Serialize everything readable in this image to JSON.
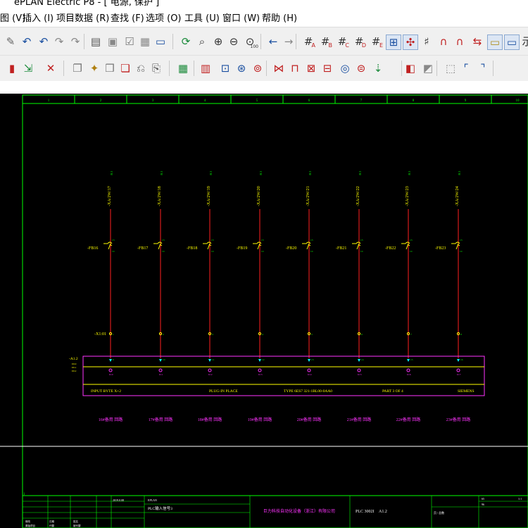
{
  "window": {
    "title_fragment": "ePLAN Electric P8 - [ 电源, 保护 ]"
  },
  "menu": {
    "items": [
      "图 (V)",
      "插入 (I)",
      "项目数据 (R)",
      "查找 (F)",
      "选项 (O)",
      "工具 (U)",
      "窗口 (W)",
      "帮助 (H)"
    ]
  },
  "toolbar1": {
    "icons": [
      "brush-icon",
      "undo-icon",
      "undo-alt-icon",
      "redo-icon",
      "redo-alt-icon",
      "page-layout-icon",
      "page-image-icon",
      "page-check-icon",
      "grid-table-icon",
      "window-icon",
      "refresh-icon",
      "zoom-window-icon",
      "zoom-in-icon",
      "zoom-out-icon",
      "zoom-100-icon",
      "back-arrow-icon",
      "forward-arrow-icon",
      "grid-a-icon",
      "grid-b-icon",
      "grid-c-icon",
      "grid-d-icon",
      "grid-e-icon",
      "grid-toggle-icon",
      "snap-icon",
      "pound-icon",
      "magnet-icon",
      "magnet-edit-icon",
      "connect-icon",
      "abc-icon",
      "panel-icon",
      "text-icon"
    ],
    "text_labels": {
      "grid_a": "A",
      "grid_b": "B",
      "grid_c": "C",
      "grid_d": "D",
      "grid_e": "E",
      "zoom100": "100",
      "tail_text": "示"
    }
  },
  "toolbar2": {
    "icons": [
      "device-nav-icon",
      "connection-icon",
      "delete-icon",
      "copy-page-icon",
      "new-page-icon",
      "page-edit-icon",
      "page-props-icon",
      "page-back-icon",
      "page-forward-icon",
      "macro-icon",
      "plc-icon",
      "terminal-strip-icon",
      "device-select-icon",
      "device-plug-icon",
      "cable-icon",
      "wire-number-icon",
      "potential-icon",
      "interrupt-icon",
      "connection-point-icon",
      "contact-icon",
      "arrow-down-icon",
      "black-box-icon",
      "structure-box-icon",
      "location-box-icon",
      "corner-left-icon",
      "corner-right-icon"
    ]
  },
  "drawing": {
    "colors": {
      "frame": "#00ff00",
      "wire": "#ff2020",
      "component": "#ffff00",
      "magenta": "#ff33ff",
      "cyan": "#00ffff",
      "white": "#ffffff"
    },
    "column_numbers": [
      "1",
      "2",
      "3",
      "4",
      "5",
      "6",
      "7",
      "8",
      "9",
      "10"
    ],
    "channels": [
      {
        "ref": "-XA/2W/17",
        "breaker": "-FB16",
        "terminal_top": "-X1:01",
        "bottom_label": "16#备用 回路"
      },
      {
        "ref": "-XA/2W/18",
        "breaker": "-FB17",
        "terminal_top": "",
        "bottom_label": "17#备用 回路"
      },
      {
        "ref": "-XA/2W/19",
        "breaker": "-FB18",
        "terminal_top": "",
        "bottom_label": "18#备用 回路"
      },
      {
        "ref": "-XA/2W/20",
        "breaker": "-FB19",
        "terminal_top": "",
        "bottom_label": "19#备用 回路"
      },
      {
        "ref": "-XA/2W/21",
        "breaker": "-FB20",
        "terminal_top": "",
        "bottom_label": "20#备用 回路"
      },
      {
        "ref": "-XA/2W/22",
        "breaker": "-FB21",
        "terminal_top": "",
        "bottom_label": "21#备用 回路"
      },
      {
        "ref": "-XA/2W/23",
        "breaker": "-FB22",
        "terminal_top": "",
        "bottom_label": "22#备用 回路"
      },
      {
        "ref": "-XA/2W/24",
        "breaker": "-FB23",
        "terminal_top": "",
        "bottom_label": "23#备用 回路"
      }
    ],
    "module": {
      "tag": "-A1.2",
      "side_labels": [
        "DI.0",
        "DI.1",
        "DI.2"
      ],
      "info_left": "INPUT BYTE  X+2",
      "info_mid": "PLUG-IN PLACE",
      "info_type": "TYPE 6ES7 321-1BL00-0AA0",
      "info_part": "PART 3 OF 4",
      "info_vendor": "SIEMENS"
    },
    "title_block": {
      "company": "巨力科技自动化设备（浙江）有限公司",
      "project_code": "PLC 3002I",
      "page": "A1.2",
      "page_desc": "PLC输入信号3",
      "row_small": [
        "修改",
        "日期",
        "姓名",
        "原始项目",
        "代替",
        "被代替"
      ],
      "checker": "2019.0.08",
      "designer": "EPLAN",
      "scale": "1:1",
      "status": "页 / 总数",
      "page_counter": "65",
      "page_total": "96"
    },
    "corner_mark": "1"
  }
}
